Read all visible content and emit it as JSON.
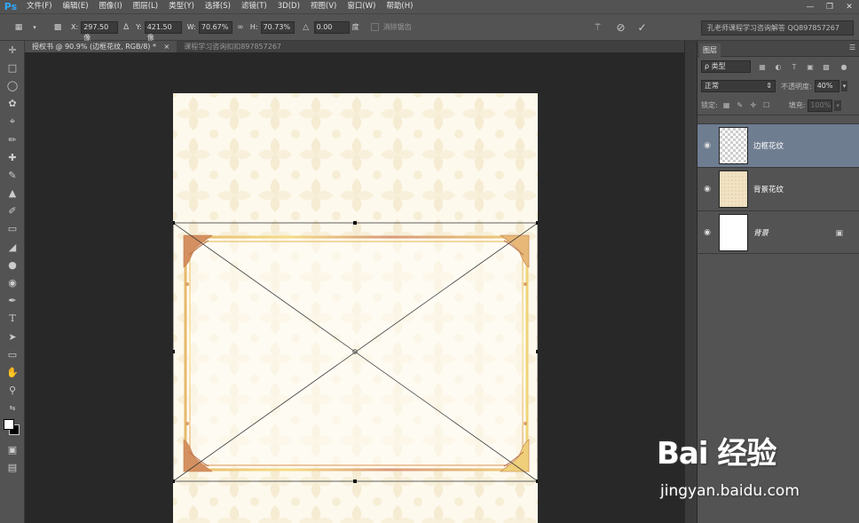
{
  "app": {
    "logo": "Ps"
  },
  "menu": [
    "文件(F)",
    "编辑(E)",
    "图像(I)",
    "图层(L)",
    "类型(Y)",
    "选择(S)",
    "滤镜(T)",
    "3D(D)",
    "视图(V)",
    "窗口(W)",
    "帮助(H)"
  ],
  "options": {
    "x_label": "X:",
    "x_value": "297.50 像",
    "y_label": "Y:",
    "y_value": "421.50 像",
    "w_label": "W:",
    "w_value": "70.67%",
    "h_label": "H:",
    "h_value": "70.73%",
    "angle_value": "0.00",
    "angle_unit": "度",
    "antialias_label": "消除锯齿",
    "workspace": "孔老师课程学习咨询解答 QQ897857267"
  },
  "tabs": [
    {
      "label": "授权书 @ 90.9% (边框花纹, RGB/8) *",
      "active": true
    },
    {
      "label": "课程学习咨询扣扣897857267",
      "active": false
    }
  ],
  "layers_panel": {
    "title": "图层",
    "filter_label": "ρ 类型",
    "blend_mode": "正常",
    "opacity_label": "不透明度:",
    "opacity_value": "40%",
    "lock_label": "锁定:",
    "fill_label": "填充:",
    "fill_value": "100%",
    "layers": [
      {
        "name": "边框花纹",
        "selected": true,
        "thumb": "transparent"
      },
      {
        "name": "背景花纹",
        "selected": false,
        "thumb": "pattern"
      },
      {
        "name": "背景",
        "selected": false,
        "thumb": "white",
        "locked": true
      }
    ]
  },
  "watermark": {
    "logo": "Bai 经验",
    "url": "jingyan.baidu.com"
  },
  "colors": {
    "frame_gold": "#e9c25a",
    "frame_copper": "#c98a5a",
    "page_bg": "#fdf9ed"
  }
}
